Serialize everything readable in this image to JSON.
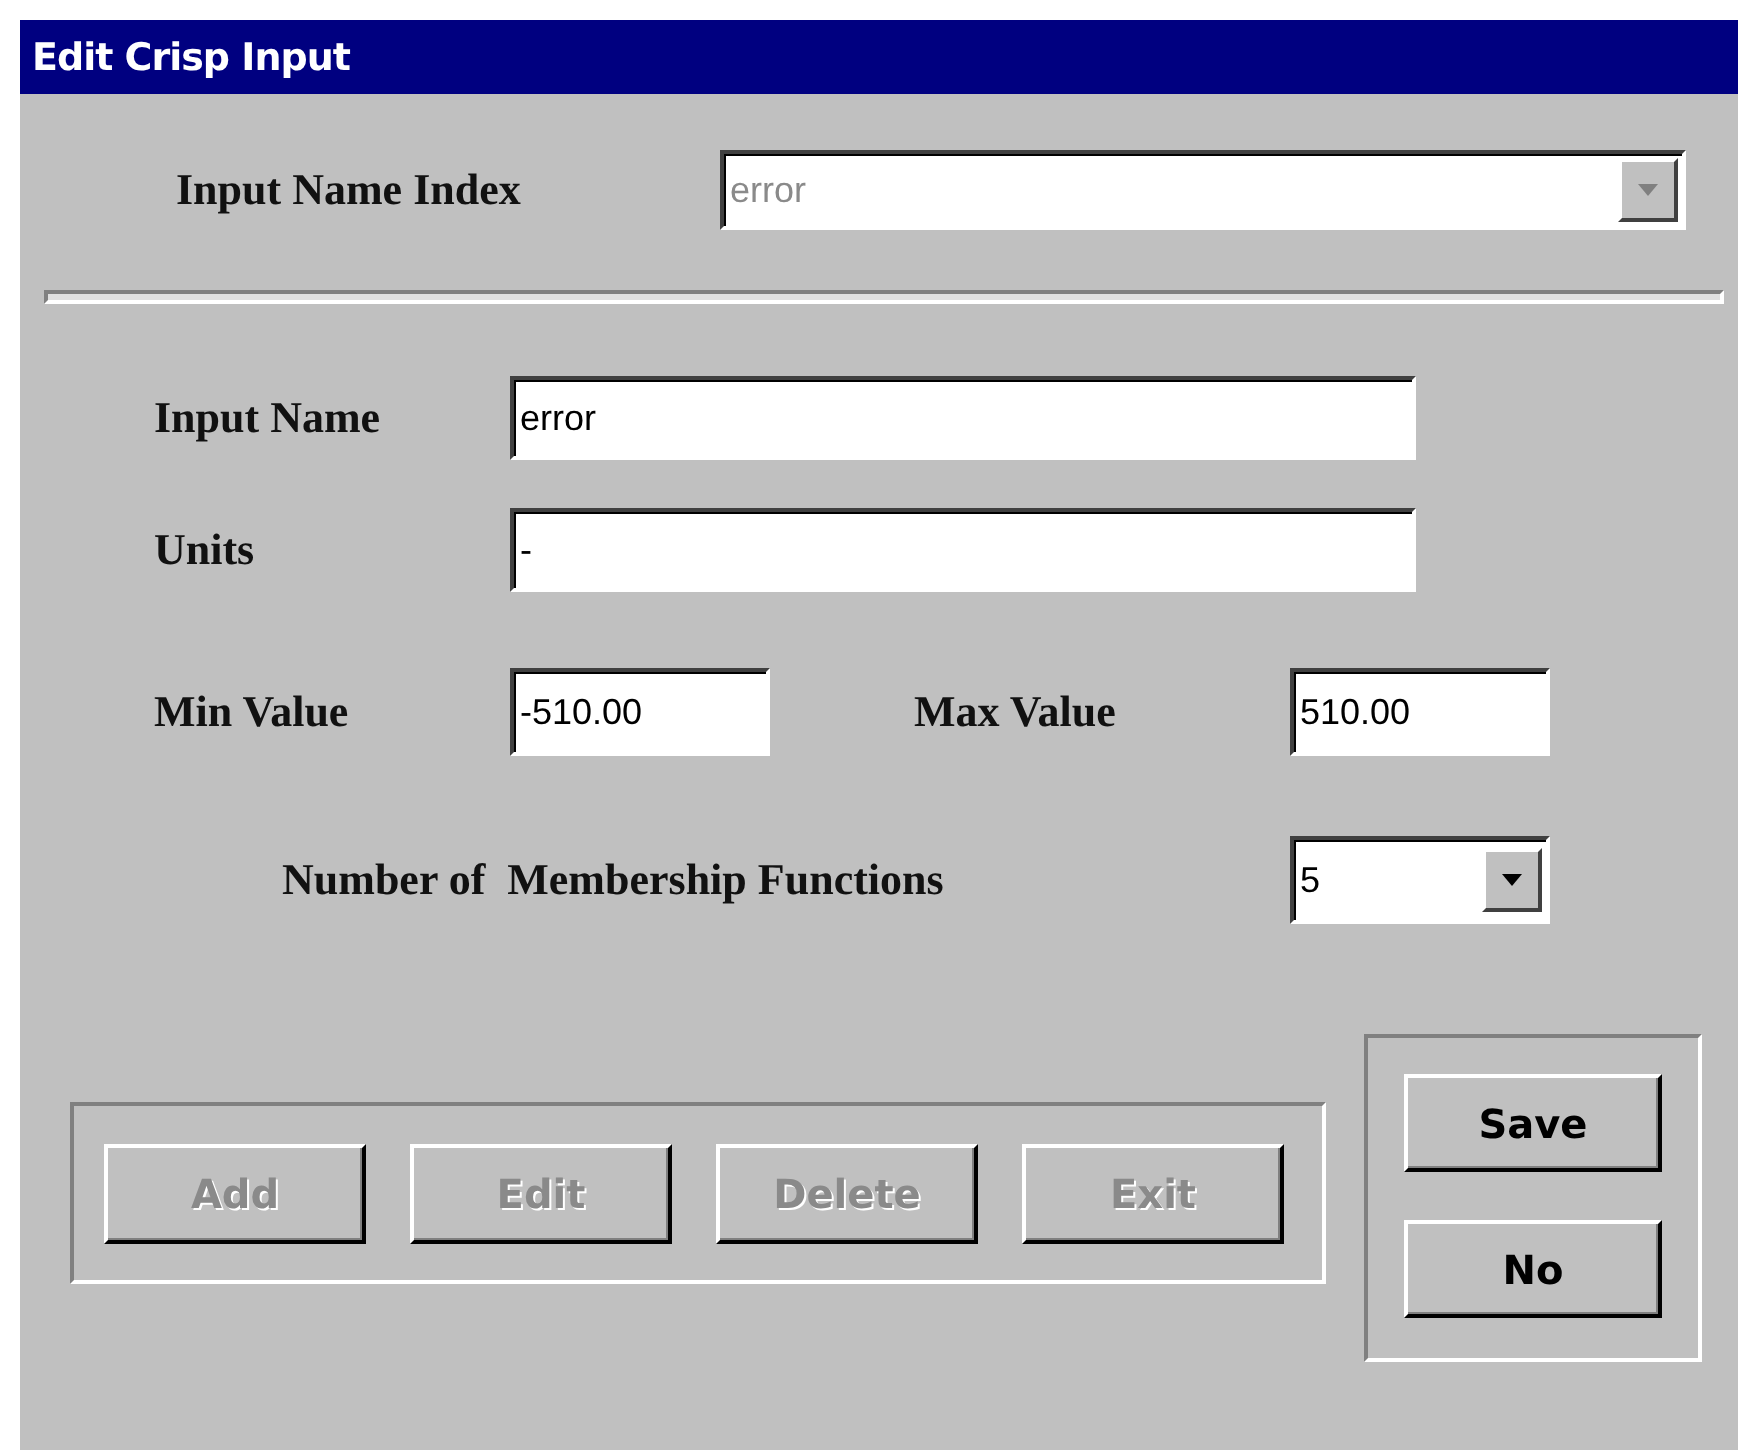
{
  "window": {
    "title": "Edit Crisp Input"
  },
  "input_name_index": {
    "label": "Input Name Index",
    "value": "error",
    "disabled": true
  },
  "input_name": {
    "label": "Input Name",
    "value": "error"
  },
  "units": {
    "label": "Units",
    "value": "-"
  },
  "min_value": {
    "label": "Min Value",
    "value": "-510.00"
  },
  "max_value": {
    "label": "Max Value",
    "value": "510.00"
  },
  "membership_functions": {
    "label": "Number of  Membership Functions",
    "value": "5",
    "disabled": false
  },
  "edit_buttons": [
    {
      "label": "Add",
      "disabled": true
    },
    {
      "label": "Edit",
      "disabled": true
    },
    {
      "label": "Delete",
      "disabled": true
    },
    {
      "label": "Exit",
      "disabled": true
    }
  ],
  "confirm_buttons": [
    {
      "label": "Save",
      "disabled": false
    },
    {
      "label": "No",
      "disabled": false
    }
  ]
}
